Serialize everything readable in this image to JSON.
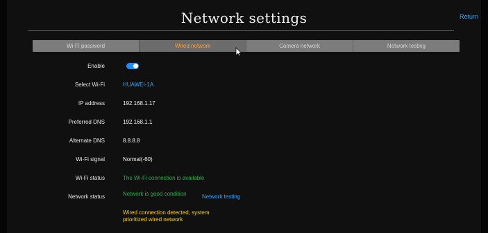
{
  "header": {
    "title": "Network settings",
    "return_label": "Return"
  },
  "tabs": [
    {
      "label": "Wi-Fi password",
      "active": false
    },
    {
      "label": "Wired network",
      "active": true
    },
    {
      "label": "Camera network",
      "active": false
    },
    {
      "label": "Network testing",
      "active": false
    }
  ],
  "fields": {
    "enable": {
      "label": "Enable",
      "value": "on"
    },
    "select_wifi": {
      "label": "Select Wi-Fi",
      "value": "HUAWEI-1A"
    },
    "ip_address": {
      "label": "IP address",
      "value": "192.168.1.17"
    },
    "preferred_dns": {
      "label": "Preferred DNS",
      "value": "192.168.1.1"
    },
    "alternate_dns": {
      "label": "Alternate DNS",
      "value": "8.8.8.8"
    },
    "wifi_signal": {
      "label": "Wi-Fi signal",
      "value": "Normal(-60)"
    },
    "wifi_status": {
      "label": "Wi-Fi status",
      "value": "The Wi-Fi connection is available"
    },
    "network_status": {
      "label": "Network status",
      "value": "Network is good condition",
      "action_label": "Network testing"
    }
  },
  "message": "Wired connection detected, system prioritized wired network",
  "colors": {
    "accent_blue": "#2aa8ff",
    "active_tab": "#ff9f2f",
    "status_green": "#2fae52",
    "warning_yellow": "#ffd400"
  },
  "icons": {
    "cursor": "mouse-pointer-icon"
  }
}
